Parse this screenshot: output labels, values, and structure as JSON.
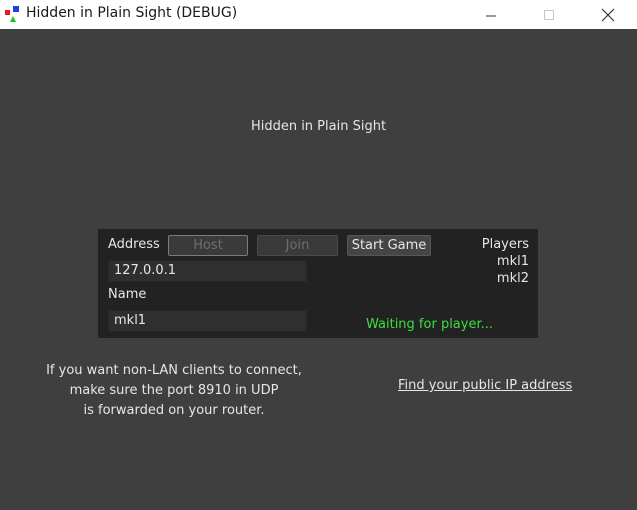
{
  "window": {
    "title": "Hidden in Plain Sight (DEBUG)"
  },
  "main": {
    "game_title": "Hidden in Plain Sight"
  },
  "lobby": {
    "address_label": "Address",
    "host_label": "Host",
    "join_label": "Join",
    "start_game_label": "Start Game",
    "address_value": "127.0.0.1",
    "name_label": "Name",
    "name_value": "mkl1",
    "players_label": "Players",
    "players": [
      "mkl1",
      "mkl2"
    ],
    "status_text": "Waiting for player..."
  },
  "info": {
    "lines": [
      "If you want non-LAN clients to connect,",
      "make sure the port 8910 in UDP",
      "is forwarded on your router."
    ],
    "link_text": "Find your public IP address"
  },
  "colors": {
    "background": "#3f3f3f",
    "panel": "#222222",
    "status": "#3ddf3d"
  }
}
